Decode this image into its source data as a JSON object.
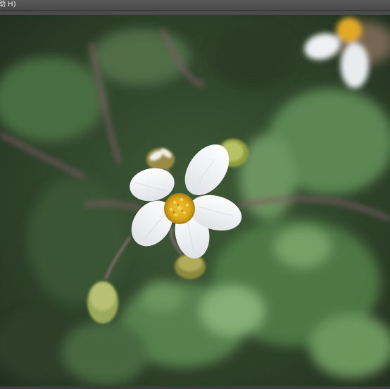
{
  "menubar": {
    "help_label": "助 H)"
  },
  "photo": {
    "subject": "flower-photo",
    "palette": {
      "background_dark": "#25311f",
      "leaf_mid": "#4f7a45",
      "leaf_light": "#7ea96e",
      "petal": "#f4f5f7",
      "center": "#e3b51e",
      "stem": "#7a5a62"
    }
  }
}
